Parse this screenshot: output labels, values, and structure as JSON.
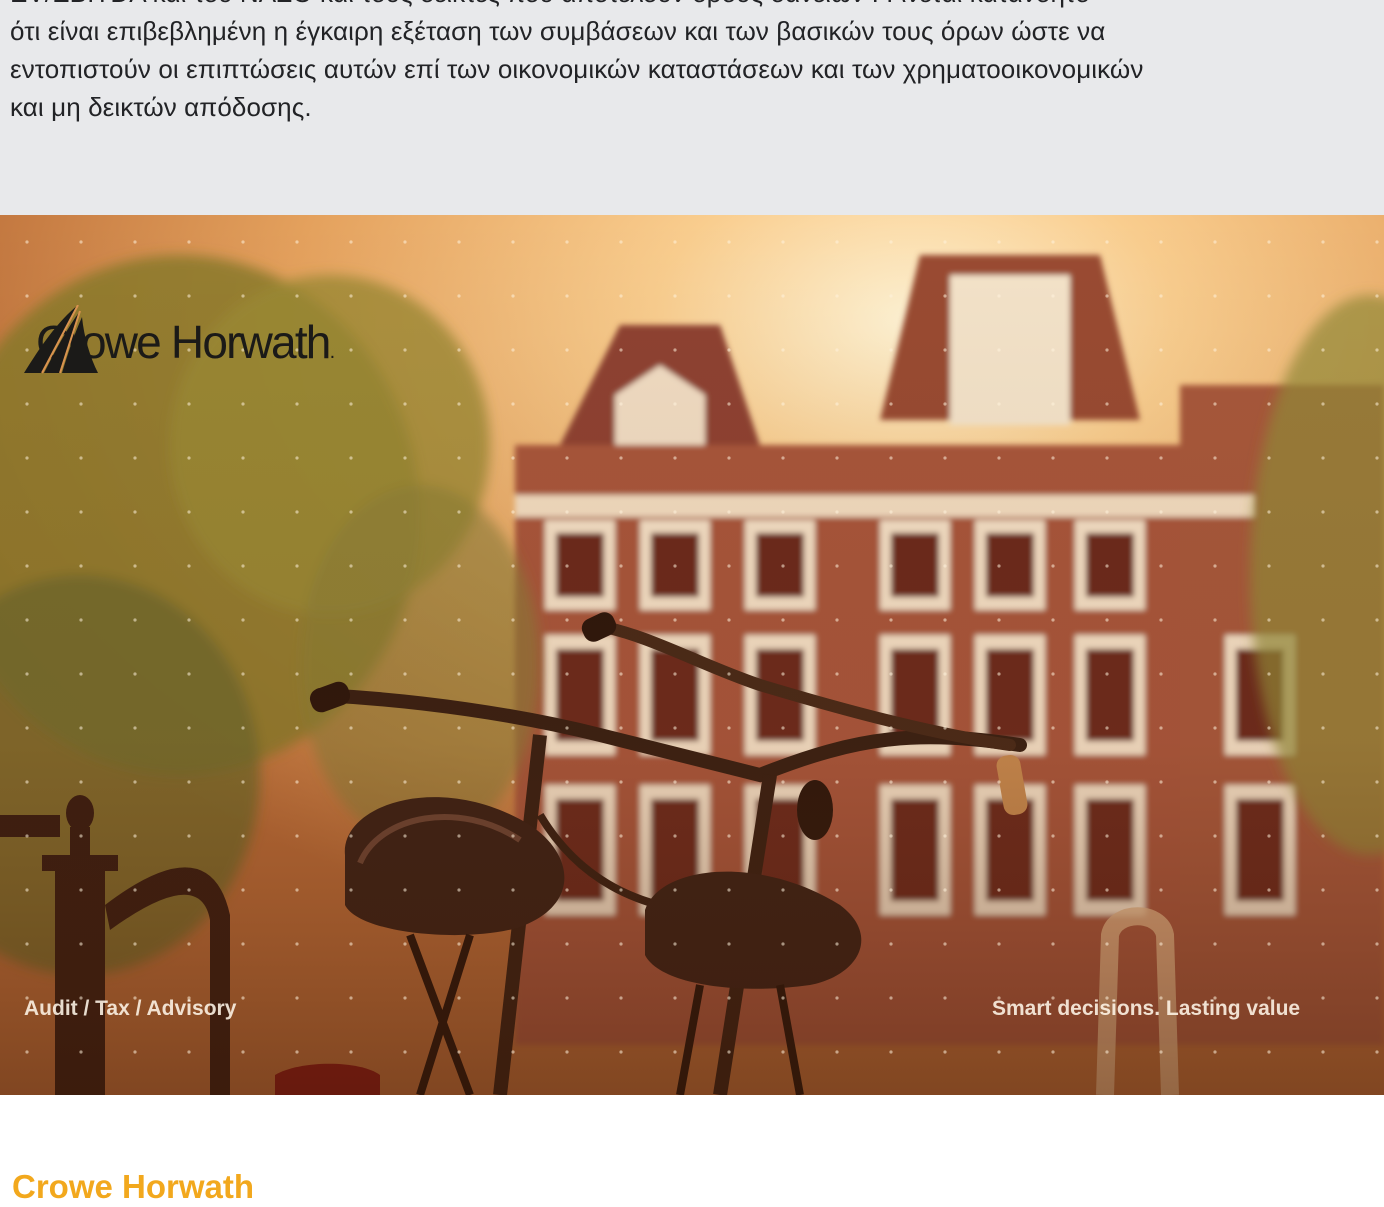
{
  "intro": {
    "lines": [
      "EV/EBITDA και του ΝΑΣΟ και τους δείκτες που αποτελούν όρους δανείων . Γίνεται κατανοητό",
      "ότι είναι επιβεβλημένη η έγκαιρη εξέταση των συμβάσεων και των βασικών τους όρων ώστε να",
      "εντοπιστούν οι επιπτώσεις αυτών επί των οικονομικών καταστάσεων και των χρηματοοικονομικών",
      "και μη δεικτών απόδοσης."
    ]
  },
  "banner": {
    "logo_text": "Crowe Horwath",
    "logo_suffix": ".",
    "tagline_left": "Audit / Tax / Advisory",
    "tagline_right": "Smart decisions.  Lasting value"
  },
  "footer": {
    "title": "Crowe Horwath"
  },
  "colors": {
    "heading_accent": "#f2a81d",
    "band_background": "#e8e9eb",
    "body_text": "#222326",
    "logo_ink": "#1b1a18"
  }
}
